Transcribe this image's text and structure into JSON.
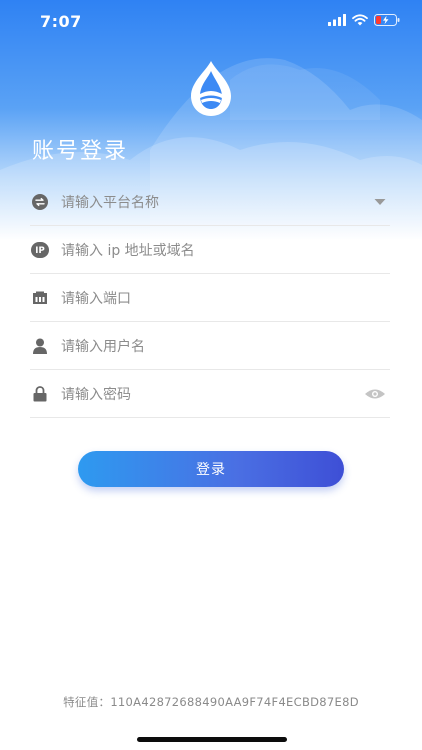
{
  "status_bar": {
    "time": "7:07"
  },
  "title": "账号登录",
  "fields": [
    {
      "icon": "switch-icon",
      "placeholder": "请输入平台名称",
      "trailing": "dropdown-arrow-icon"
    },
    {
      "icon": "ip-icon",
      "placeholder": "请输入 ip 地址或域名",
      "ip_badge": "IP"
    },
    {
      "icon": "port-icon",
      "placeholder": "请输入端口"
    },
    {
      "icon": "user-icon",
      "placeholder": "请输入用户名"
    },
    {
      "icon": "lock-icon",
      "placeholder": "请输入密码",
      "trailing": "eye-icon"
    }
  ],
  "login_button": "登录",
  "feature_label": "特征值：",
  "feature_value": "110A42872688490AA9F74F4ECBD87E8D",
  "colors": {
    "primary": "#2f82f3",
    "button_start": "#2e9af0",
    "button_end": "#3e4fd6"
  }
}
